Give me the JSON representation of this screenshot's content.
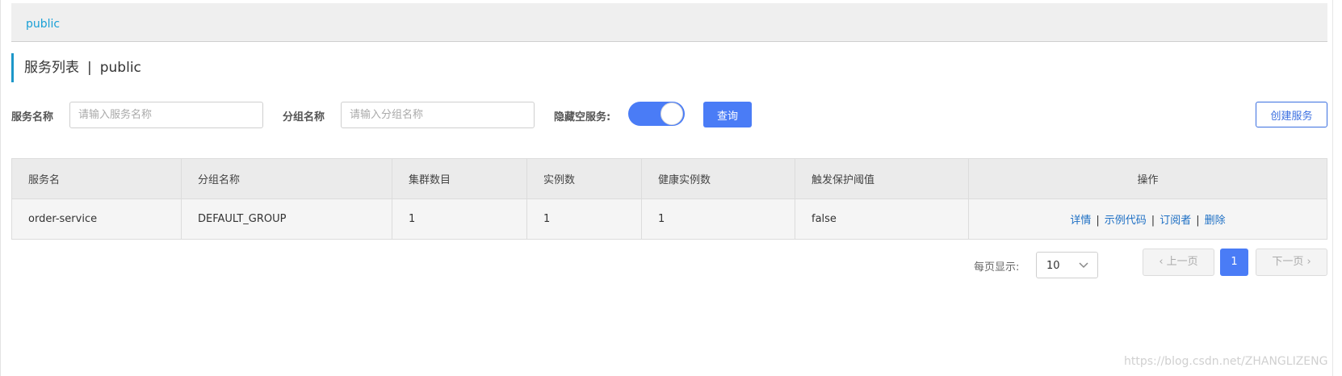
{
  "namespace_bar": {
    "active_tab": "public"
  },
  "page_title": {
    "title": "服务列表",
    "separator": "|",
    "namespace": "public"
  },
  "search": {
    "service_name_label": "服务名称",
    "service_name_placeholder": "请输入服务名称",
    "group_name_label": "分组名称",
    "group_name_placeholder": "请输入分组名称",
    "hide_empty_label": "隐藏空服务:",
    "hide_empty_on": true,
    "query_button": "查询",
    "create_button": "创建服务"
  },
  "table": {
    "columns": [
      "服务名",
      "分组名称",
      "集群数目",
      "实例数",
      "健康实例数",
      "触发保护阈值",
      "操作"
    ],
    "rows": [
      {
        "service_name": "order-service",
        "group_name": "DEFAULT_GROUP",
        "cluster_count": "1",
        "instance_count": "1",
        "healthy_instance_count": "1",
        "protect_threshold": "false",
        "actions": [
          "详情",
          "示例代码",
          "订阅者",
          "删除"
        ]
      }
    ]
  },
  "pagination": {
    "per_page_label": "每页显示:",
    "per_page_value": "10",
    "prev_label": "上一页",
    "current_page": "1",
    "next_label": "下一页"
  },
  "watermark": "https://blog.csdn.net/ZHANGLIZENG",
  "colors": {
    "accent": "#4a7cf6",
    "link": "#1d6fc4",
    "tab": "#1aa0d6"
  }
}
